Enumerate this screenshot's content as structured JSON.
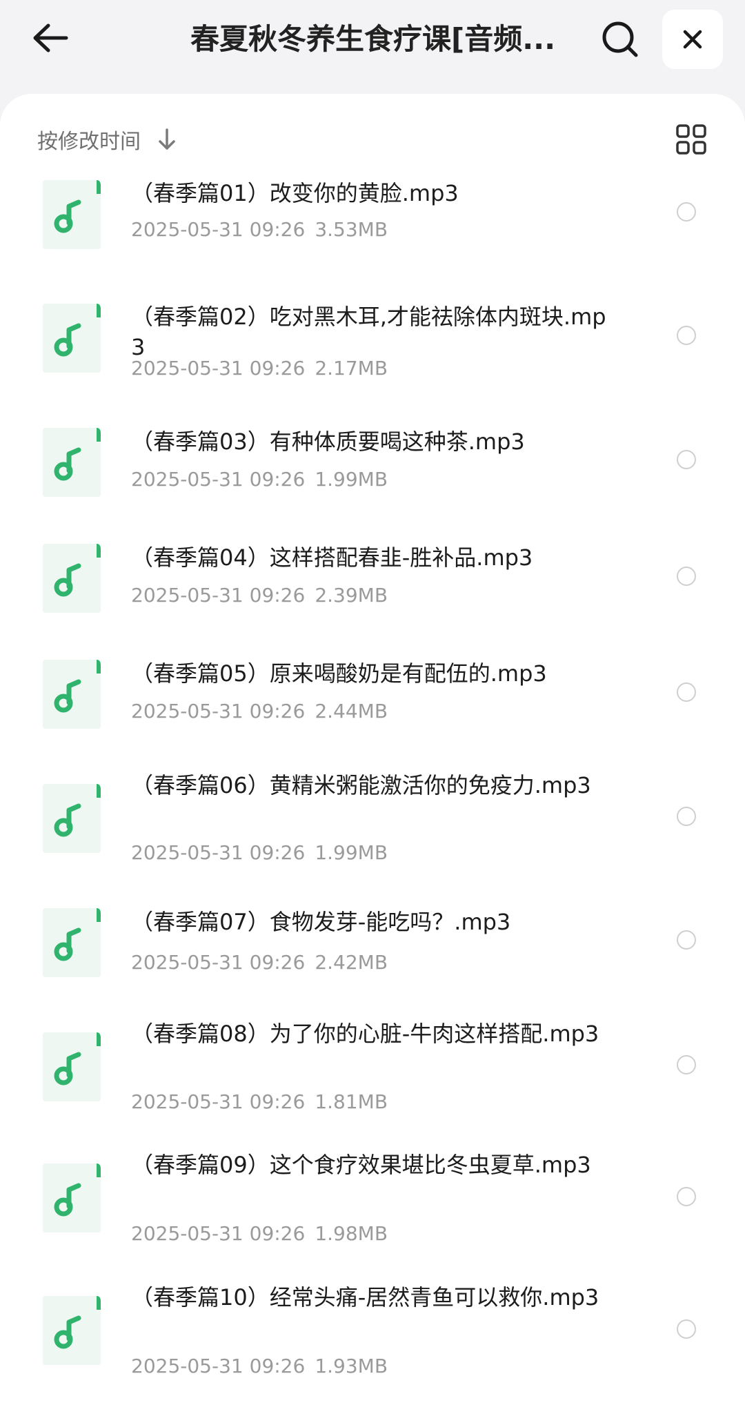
{
  "header": {
    "title": "春夏秋冬养生食疗课[音频...",
    "back_icon": "arrow-left-icon",
    "search_icon": "search-icon",
    "close_icon": "close-icon"
  },
  "toolbar": {
    "sort_label": "按修改时间",
    "sort_icon": "arrow-down-icon",
    "view_icon": "grid-view-icon"
  },
  "colors": {
    "accent": "#2fb36d",
    "icon_bg": "#eef7f1",
    "text_primary": "#1c1c1c",
    "text_secondary": "#9a9a9a"
  },
  "files": [
    {
      "name": "（春季篇01）改变你的黄脸.mp3",
      "date": "2025-05-31 09:26",
      "size": "3.53MB"
    },
    {
      "name": "（春季篇02）吃对黑木耳,才能祛除体内斑块.mp3",
      "date": "2025-05-31 09:26",
      "size": "2.17MB"
    },
    {
      "name": "（春季篇03）有种体质要喝这种茶.mp3",
      "date": "2025-05-31 09:26",
      "size": "1.99MB"
    },
    {
      "name": "（春季篇04）这样搭配春韭-胜补品.mp3",
      "date": "2025-05-31 09:26",
      "size": "2.39MB"
    },
    {
      "name": "（春季篇05）原来喝酸奶是有配伍的.mp3",
      "date": "2025-05-31 09:26",
      "size": "2.44MB"
    },
    {
      "name": "（春季篇06）黄精米粥能激活你的免疫力.mp3",
      "date": "2025-05-31 09:26",
      "size": "1.99MB"
    },
    {
      "name": "（春季篇07）食物发芽-能吃吗？.mp3",
      "date": "2025-05-31 09:26",
      "size": "2.42MB"
    },
    {
      "name": "（春季篇08）为了你的心脏-牛肉这样搭配.mp3",
      "date": "2025-05-31 09:26",
      "size": "1.81MB"
    },
    {
      "name": "（春季篇09）这个食疗效果堪比冬虫夏草.mp3",
      "date": "2025-05-31 09:26",
      "size": "1.98MB"
    },
    {
      "name": "（春季篇10）经常头痛-居然青鱼可以救你.mp3",
      "date": "2025-05-31 09:26",
      "size": "1.93MB"
    }
  ]
}
